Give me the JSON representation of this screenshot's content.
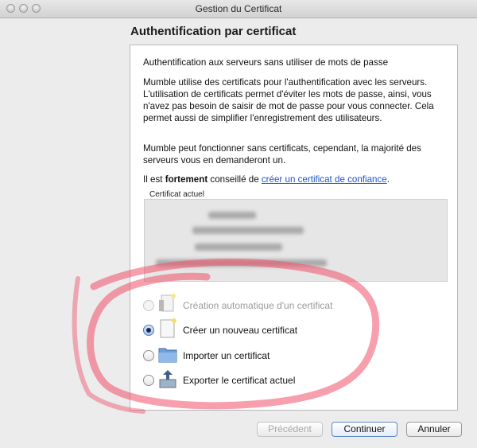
{
  "window": {
    "title": "Gestion du Certificat"
  },
  "page": {
    "heading": "Authentification par certificat"
  },
  "intro": {
    "p1": "Authentification aux serveurs sans utiliser de mots de passe",
    "p2": "Mumble utilise des certificats pour l'authentification avec les serveurs. L'utilisation de certificats permet d'éviter les mots de passe, ainsi, vous n'avez pas besoin de saisir de mot de passe pour vous connecter. Cela permet aussi de simplifier l'enregistrement des utilisateurs.",
    "p3": "Mumble peut fonctionner sans certificats, cependant, la majorité des serveurs vous en demanderont un.",
    "p4_before": "Il est ",
    "p4_bold": "fortement",
    "p4_middle": " conseillé de ",
    "p4_link": "créer un certificat de confiance",
    "p4_after": "."
  },
  "current_certificate": {
    "label": "Certificat actuel"
  },
  "options": [
    {
      "label": "Création automatique d'un certificat",
      "selected": false,
      "enabled": false,
      "icon": "auto-certificate-icon"
    },
    {
      "label": "Créer un nouveau certificat",
      "selected": true,
      "enabled": true,
      "icon": "new-certificate-icon"
    },
    {
      "label": "Importer un certificat",
      "selected": false,
      "enabled": true,
      "icon": "folder-icon"
    },
    {
      "label": "Exporter le certificat actuel",
      "selected": false,
      "enabled": true,
      "icon": "export-icon"
    }
  ],
  "buttons": {
    "previous": "Précédent",
    "continue": "Continuer",
    "cancel": "Annuler"
  },
  "colors": {
    "link": "#1a55c8",
    "annotation": "#f0506a"
  }
}
